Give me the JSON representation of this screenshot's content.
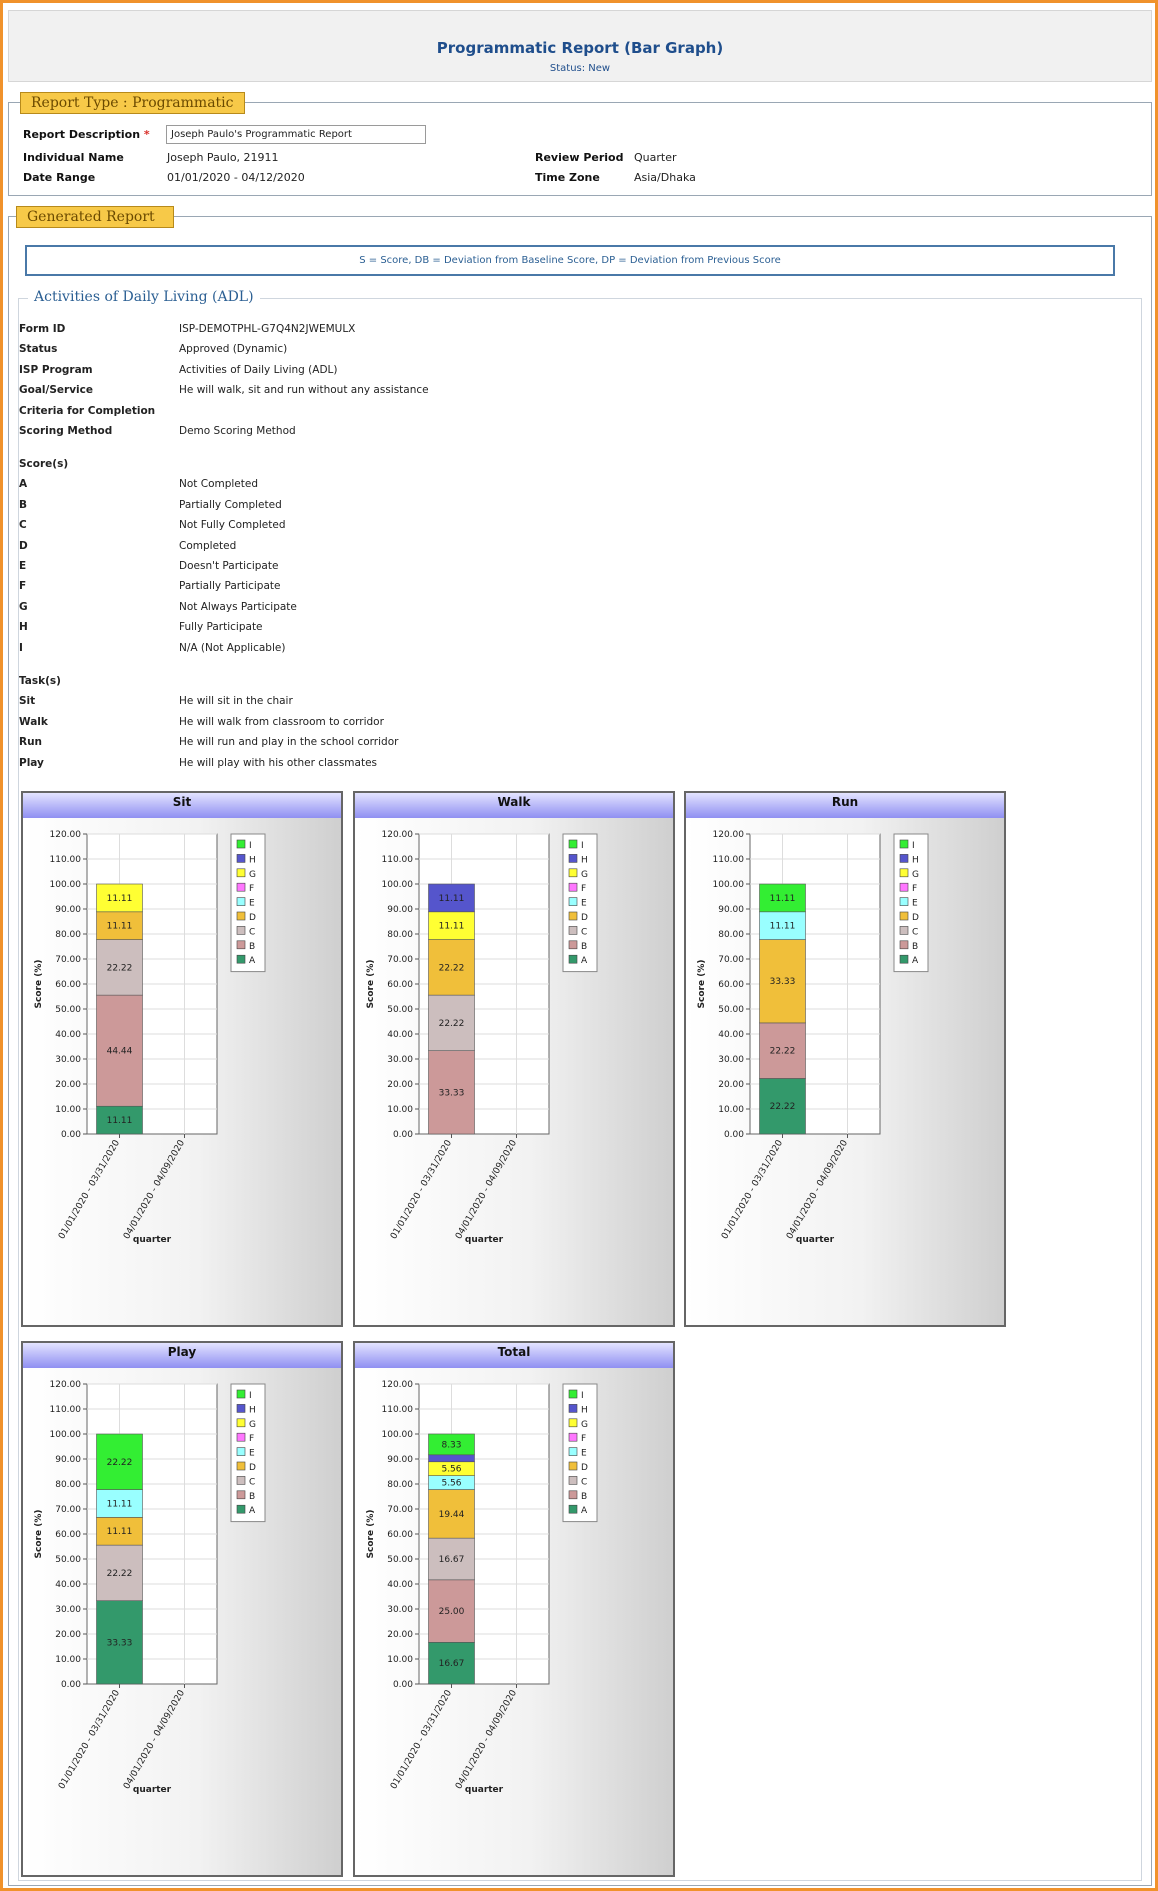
{
  "header": {
    "title": "Programmatic Report (Bar Graph)",
    "status": "Status: New"
  },
  "report_type": {
    "legend": "Report Type :  Programmatic",
    "description_label": "Report Description",
    "required_mark": "*",
    "description_value": "Joseph Paulo's Programmatic Report",
    "individual_label": "Individual Name",
    "individual_value": "Joseph  Paulo,  21911",
    "date_label": "Date Range",
    "date_value": "01/01/2020 - 04/12/2020",
    "review_label": "Review Period",
    "review_value": "Quarter",
    "timezone_label": "Time Zone",
    "timezone_value": "Asia/Dhaka"
  },
  "generated": {
    "legend": "Generated Report",
    "key_text": "S = Score,  DB = Deviation from Baseline Score,  DP = Deviation from Previous Score"
  },
  "adl": {
    "title": "Activities of Daily Living (ADL)",
    "info": [
      {
        "label": "Form ID",
        "value": "ISP-DEMOTPHL-G7Q4N2JWEMULX"
      },
      {
        "label": "Status",
        "value": "Approved (Dynamic)"
      },
      {
        "label": "ISP Program",
        "value": "Activities of Daily Living (ADL)"
      },
      {
        "label": "Goal/Service",
        "value": "He will walk, sit and run without any assistance"
      },
      {
        "label": "Criteria for Completion",
        "value": ""
      },
      {
        "label": "Scoring Method",
        "value": "Demo Scoring Method"
      }
    ],
    "scores_heading": "Score(s)",
    "scores": [
      {
        "code": "A",
        "desc": "Not Completed"
      },
      {
        "code": "B",
        "desc": "Partially Completed"
      },
      {
        "code": "C",
        "desc": "Not Fully Completed"
      },
      {
        "code": "D",
        "desc": "Completed"
      },
      {
        "code": "E",
        "desc": "Doesn't Participate"
      },
      {
        "code": "F",
        "desc": "Partially Participate"
      },
      {
        "code": "G",
        "desc": "Not Always Participate"
      },
      {
        "code": "H",
        "desc": "Fully Participate"
      },
      {
        "code": "I",
        "desc": "N/A (Not Applicable)"
      }
    ],
    "tasks_heading": "Task(s)",
    "tasks": [
      {
        "name": "Sit",
        "desc": "He will sit in the chair"
      },
      {
        "name": "Walk",
        "desc": "He will walk from classroom to corridor"
      },
      {
        "name": "Run",
        "desc": "He will run and play in the school corridor"
      },
      {
        "name": "Play",
        "desc": "He will play with his other classmates"
      }
    ]
  },
  "colors": {
    "A": "#33996b",
    "B": "#cc9999",
    "C": "#ccbebe",
    "D": "#f0bf3a",
    "E": "#99ffff",
    "F": "#ff77ff",
    "G": "#ffff33",
    "H": "#5555cc",
    "I": "#33ee33"
  },
  "chart_data": [
    {
      "type": "bar",
      "stacked": true,
      "title": "Sit",
      "categories": [
        "01/01/2020 - 03/31/2020",
        "04/01/2020 - 04/09/2020"
      ],
      "xlabel": "quarter",
      "ylabel": "Score (%)",
      "ylim": [
        0,
        120
      ],
      "yticks": [
        "0.00",
        "10.00",
        "20.00",
        "30.00",
        "40.00",
        "50.00",
        "60.00",
        "70.00",
        "80.00",
        "90.00",
        "100.00",
        "110.00",
        "120.00"
      ],
      "legend": [
        "I",
        "H",
        "G",
        "F",
        "E",
        "D",
        "C",
        "B",
        "A"
      ],
      "series": [
        {
          "name": "A",
          "values": [
            11.11,
            0
          ],
          "label": "11.11"
        },
        {
          "name": "B",
          "values": [
            44.44,
            0
          ],
          "label": "44.44"
        },
        {
          "name": "C",
          "values": [
            22.22,
            0
          ],
          "label": "22.22"
        },
        {
          "name": "D",
          "values": [
            11.11,
            0
          ],
          "label": "11.11"
        },
        {
          "name": "G",
          "values": [
            11.11,
            0
          ],
          "label": "11.11"
        }
      ]
    },
    {
      "type": "bar",
      "stacked": true,
      "title": "Walk",
      "categories": [
        "01/01/2020 - 03/31/2020",
        "04/01/2020 - 04/09/2020"
      ],
      "xlabel": "quarter",
      "ylabel": "Score (%)",
      "ylim": [
        0,
        120
      ],
      "yticks": [
        "0.00",
        "10.00",
        "20.00",
        "30.00",
        "40.00",
        "50.00",
        "60.00",
        "70.00",
        "80.00",
        "90.00",
        "100.00",
        "110.00",
        "120.00"
      ],
      "legend": [
        "I",
        "H",
        "G",
        "F",
        "E",
        "D",
        "C",
        "B",
        "A"
      ],
      "series": [
        {
          "name": "B",
          "values": [
            33.33,
            0
          ],
          "label": "33.33"
        },
        {
          "name": "C",
          "values": [
            22.22,
            0
          ],
          "label": "22.22"
        },
        {
          "name": "D",
          "values": [
            22.22,
            0
          ],
          "label": "22.22"
        },
        {
          "name": "G",
          "values": [
            11.11,
            0
          ],
          "label": "11.11"
        },
        {
          "name": "H",
          "values": [
            11.11,
            0
          ],
          "label": "11.11"
        }
      ]
    },
    {
      "type": "bar",
      "stacked": true,
      "title": "Run",
      "categories": [
        "01/01/2020 - 03/31/2020",
        "04/01/2020 - 04/09/2020"
      ],
      "xlabel": "quarter",
      "ylabel": "Score (%)",
      "ylim": [
        0,
        120
      ],
      "yticks": [
        "0.00",
        "10.00",
        "20.00",
        "30.00",
        "40.00",
        "50.00",
        "60.00",
        "70.00",
        "80.00",
        "90.00",
        "100.00",
        "110.00",
        "120.00"
      ],
      "legend": [
        "I",
        "H",
        "G",
        "F",
        "E",
        "D",
        "C",
        "B",
        "A"
      ],
      "series": [
        {
          "name": "A",
          "values": [
            22.22,
            0
          ],
          "label": "22.22"
        },
        {
          "name": "B",
          "values": [
            22.22,
            0
          ],
          "label": "22.22"
        },
        {
          "name": "D",
          "values": [
            33.33,
            0
          ],
          "label": "33.33"
        },
        {
          "name": "E",
          "values": [
            11.11,
            0
          ],
          "label": "11.11"
        },
        {
          "name": "I",
          "values": [
            11.11,
            0
          ],
          "label": "11.11"
        }
      ]
    },
    {
      "type": "bar",
      "stacked": true,
      "title": "Play",
      "categories": [
        "01/01/2020 - 03/31/2020",
        "04/01/2020 - 04/09/2020"
      ],
      "xlabel": "quarter",
      "ylabel": "Score (%)",
      "ylim": [
        0,
        120
      ],
      "yticks": [
        "0.00",
        "10.00",
        "20.00",
        "30.00",
        "40.00",
        "50.00",
        "60.00",
        "70.00",
        "80.00",
        "90.00",
        "100.00",
        "110.00",
        "120.00"
      ],
      "legend": [
        "I",
        "H",
        "G",
        "F",
        "E",
        "D",
        "C",
        "B",
        "A"
      ],
      "series": [
        {
          "name": "A",
          "values": [
            33.33,
            0
          ],
          "label": "33.33"
        },
        {
          "name": "C",
          "values": [
            22.22,
            0
          ],
          "label": "22.22"
        },
        {
          "name": "D",
          "values": [
            11.11,
            0
          ],
          "label": "11.11"
        },
        {
          "name": "E",
          "values": [
            11.11,
            0
          ],
          "label": "11.11"
        },
        {
          "name": "I",
          "values": [
            22.22,
            0
          ],
          "label": "22.22"
        }
      ]
    },
    {
      "type": "bar",
      "stacked": true,
      "title": "Total",
      "categories": [
        "01/01/2020 - 03/31/2020",
        "04/01/2020 - 04/09/2020"
      ],
      "xlabel": "quarter",
      "ylabel": "Score (%)",
      "ylim": [
        0,
        120
      ],
      "yticks": [
        "0.00",
        "10.00",
        "20.00",
        "30.00",
        "40.00",
        "50.00",
        "60.00",
        "70.00",
        "80.00",
        "90.00",
        "100.00",
        "110.00",
        "120.00"
      ],
      "legend": [
        "I",
        "H",
        "G",
        "F",
        "E",
        "D",
        "C",
        "B",
        "A"
      ],
      "series": [
        {
          "name": "A",
          "values": [
            16.67,
            0
          ],
          "label": "16.67"
        },
        {
          "name": "B",
          "values": [
            25.0,
            0
          ],
          "label": "25.00"
        },
        {
          "name": "C",
          "values": [
            16.67,
            0
          ],
          "label": "16.67"
        },
        {
          "name": "D",
          "values": [
            19.44,
            0
          ],
          "label": "19.44"
        },
        {
          "name": "E",
          "values": [
            5.56,
            0
          ],
          "label": "5.56"
        },
        {
          "name": "G",
          "values": [
            5.56,
            0
          ],
          "label": "5.56"
        },
        {
          "name": "H",
          "values": [
            2.78,
            0
          ],
          "label": ""
        },
        {
          "name": "I",
          "values": [
            8.33,
            0
          ],
          "label": "8.33"
        }
      ]
    }
  ]
}
